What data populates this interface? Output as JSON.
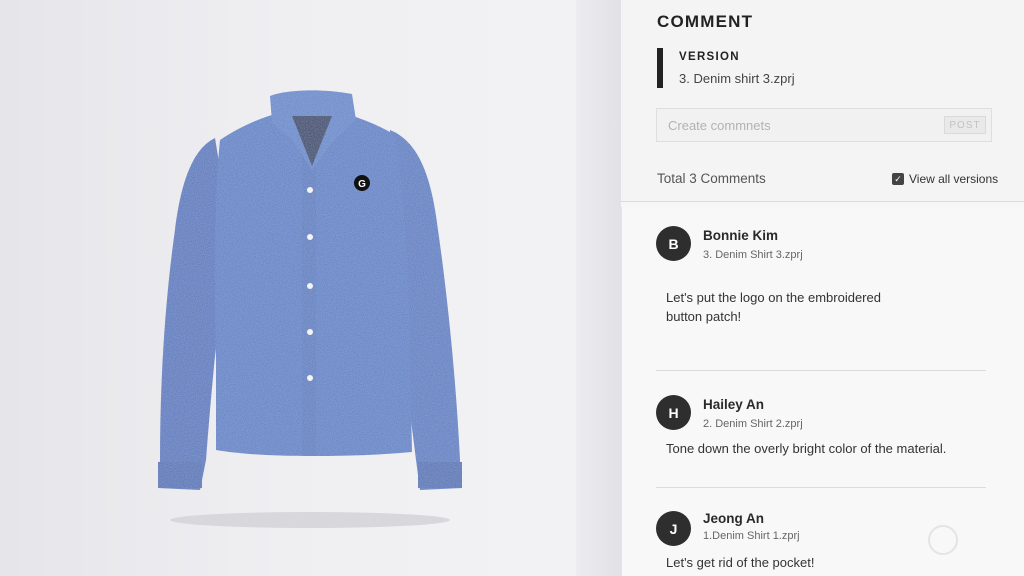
{
  "panel": {
    "title": "COMMENT",
    "version_label": "VERSION",
    "version_file": "3. Denim shirt 3.zprj",
    "input_placeholder": "Create commnets",
    "post_label": "POST",
    "total": "Total 3 Comments",
    "view_all_label": "View all versions",
    "view_all_checked": true
  },
  "comments": [
    {
      "initial": "B",
      "author": "Bonnie Kim",
      "file": "3. Denim Shirt 3.zprj",
      "text": "Let's put the logo on the embroidered button patch!"
    },
    {
      "initial": "H",
      "author": "Hailey An",
      "file": "2. Denim Shirt 2.zprj",
      "text": "Tone down the overly bright color of the material."
    },
    {
      "initial": "J",
      "author": "Jeong An",
      "file": "1.Denim Shirt 1.zprj",
      "text": "Let's get rid of the pocket!"
    }
  ],
  "colors": {
    "shirt": "#5b7fc6",
    "avatar": "#2e2e2e"
  },
  "viewport": {
    "logo_letter": "G"
  }
}
